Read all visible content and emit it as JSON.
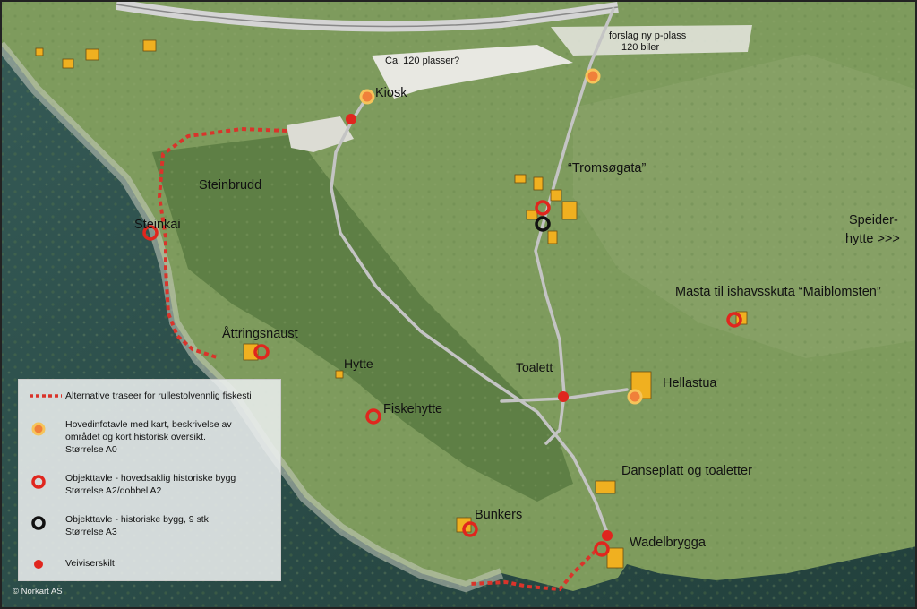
{
  "labels": {
    "kiosk": "Kiosk",
    "parking_existing": "Ca. 120 plasser?",
    "parking_new_line1": "forslag ny p-plass",
    "parking_new_line2": "120 biler",
    "tromsogata": "“Tromsøgata”",
    "steinbrudd": "Steinbrudd",
    "steinkai": "Steinkai",
    "speider1": "Speider-",
    "speider2": "hytte >>>",
    "masta": "Masta til ishavsskuta “Maiblomsten”",
    "attringsnaust": "Åttringsnaust",
    "hytte": "Hytte",
    "toalett": "Toalett",
    "hellastua": "Hellastua",
    "fiskehytte": "Fiskehytte",
    "danseplatt": "Danseplatt og toaletter",
    "bunkers": "Bunkers",
    "wadelbrygga": "Wadelbrygga"
  },
  "legend": {
    "item1": "Alternative traseer for rullestolvennlig fiskesti",
    "item2_l1": "Hovedinfotavle med kart, beskrivelse av",
    "item2_l2": "området og kort historisk oversikt.",
    "item2_l3": "Størrelse A0",
    "item3_l1": "Objekttavle - hovedsaklig historiske bygg",
    "item3_l2": "Størrelse A2/dobbel A2",
    "item4_l1": "Objekttavle - historiske bygg, 9 stk",
    "item4_l2": "Størrelse A3",
    "item5": "Veiviserskilt"
  },
  "copyright": "© Norkart AS",
  "colors": {
    "sea": "#2f4e4a",
    "land": "#7d9a5c",
    "forest": "#53733f",
    "road": "#c9c9c9",
    "path_dotted": "#d9342b",
    "marker_red": "#e0261e",
    "marker_orange": "#f0803a",
    "building": "#f0b020"
  },
  "icons": [
    "info-board-icon",
    "object-board-icon",
    "historic-board-icon",
    "signpost-icon"
  ]
}
